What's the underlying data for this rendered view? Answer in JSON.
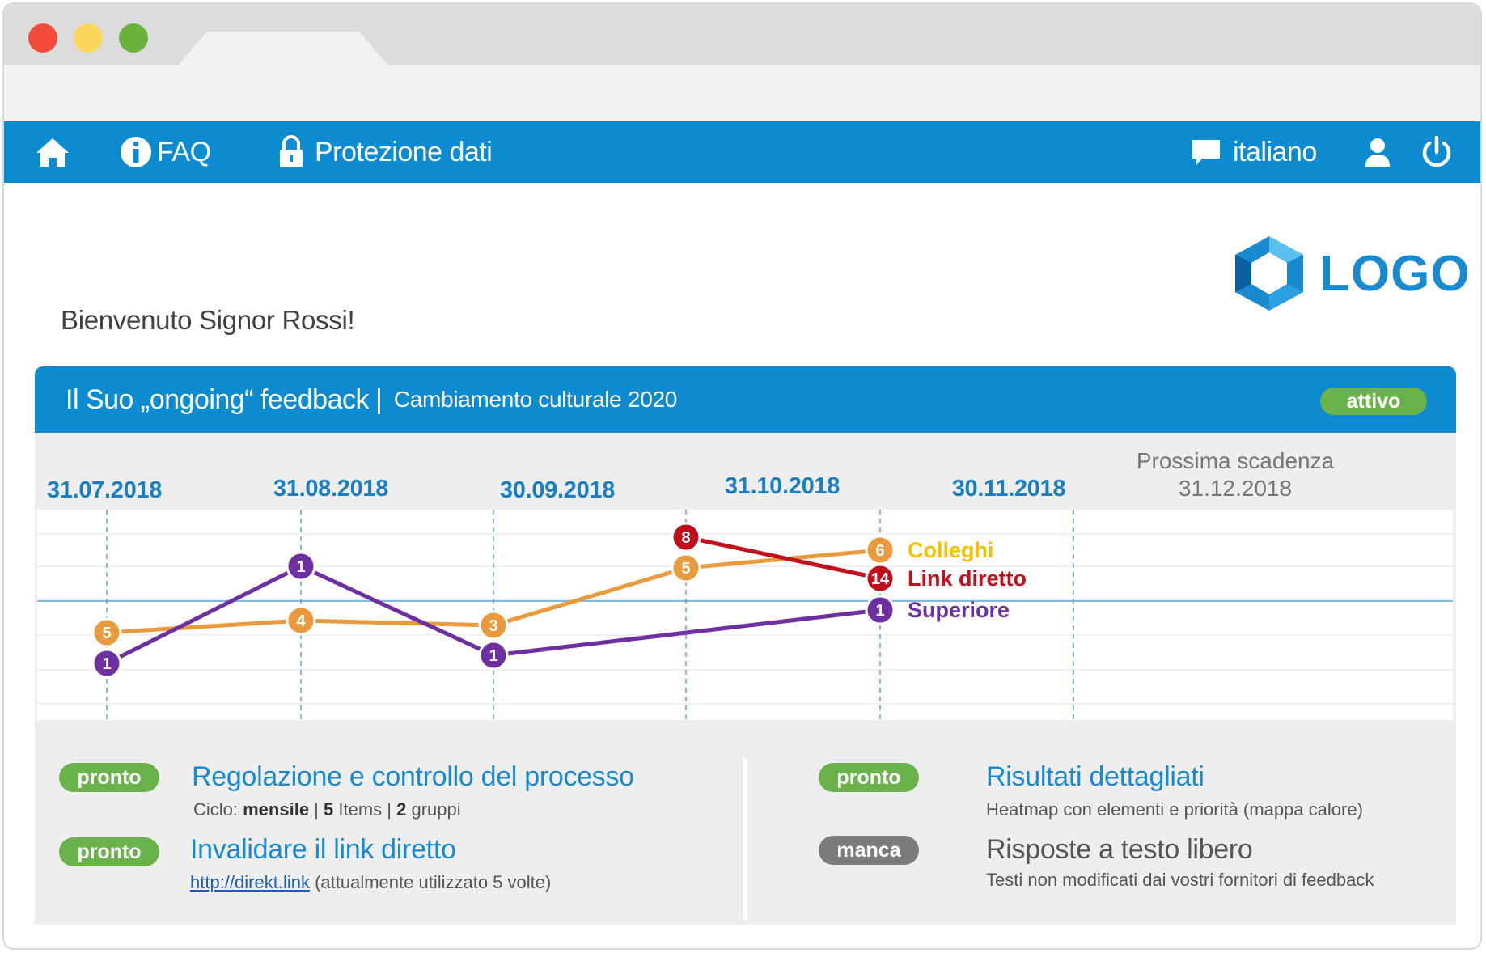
{
  "nav": {
    "faq_label": "FAQ",
    "privacy_label": "Protezione dati",
    "language_label": "italiano"
  },
  "welcome": "Bienvenuto Signor Rossi!",
  "logo_text": "LOGO",
  "panel": {
    "title": "Il Suo „ongoing“ feedback",
    "separator": "|",
    "subtitle": "Cambiamento culturale 2020",
    "status": "attivo"
  },
  "timeline": {
    "dates": [
      "31.07.2018",
      "31.08.2018",
      "30.09.2018",
      "31.10.2018",
      "30.11.2018"
    ],
    "next_title": "Prossima scadenza",
    "next_date": "31.12.2018"
  },
  "chart_data": {
    "type": "line",
    "x": [
      "31.07.2018",
      "31.08.2018",
      "30.09.2018",
      "31.10.2018",
      "30.11.2018"
    ],
    "series": [
      {
        "name": "Colleghi",
        "color": "#e89a3c",
        "points": [
          {
            "x": "31.07.2018",
            "y": 5
          },
          {
            "x": "31.08.2018",
            "y": 4
          },
          {
            "x": "30.09.2018",
            "y": 3
          },
          {
            "x": "31.10.2018",
            "y": 5
          },
          {
            "x": "30.11.2018",
            "y": 6
          }
        ]
      },
      {
        "name": "Link diretto",
        "color": "#c0101c",
        "points": [
          {
            "x": "31.10.2018",
            "y": 8
          },
          {
            "x": "30.11.2018",
            "y": 14
          }
        ]
      },
      {
        "name": "Superiore",
        "color": "#6e2fa0",
        "points": [
          {
            "x": "31.07.2018",
            "y": 1
          },
          {
            "x": "31.08.2018",
            "y": 1
          },
          {
            "x": "30.09.2018",
            "y": 1
          },
          {
            "x": "30.11.2018",
            "y": 1
          }
        ]
      }
    ],
    "legend_colors": {
      "Colleghi": "#f2c200",
      "Link diretto": "#c0101c",
      "Superiore": "#6e2fa0"
    }
  },
  "tasks": {
    "left": [
      {
        "status": "pronto",
        "title": "Regolazione e controllo del processo",
        "sub_prefix": "Ciclo: ",
        "sub_cycle": "mensile",
        "sub_sep1": " | ",
        "sub_items_num": "5",
        "sub_items": " Items | ",
        "sub_groups_num": "2",
        "sub_groups": " gruppi"
      },
      {
        "status": "pronto",
        "title": "Invalidare il link diretto",
        "link": "http://direkt.link",
        "link_note": " (attualmente utilizzato 5 volte)"
      }
    ],
    "right": [
      {
        "status": "pronto",
        "title": "Risultati dettagliati",
        "sub": "Heatmap con elementi e priorità (mappa calore)"
      },
      {
        "status": "manca",
        "title": "Risposte a testo libero",
        "sub": "Testi non modificati dai vostri fornitori di feedback"
      }
    ]
  },
  "colors": {
    "brand": "#0d8bd0",
    "ready": "#6ab34a",
    "missing": "#7b7b7b"
  }
}
